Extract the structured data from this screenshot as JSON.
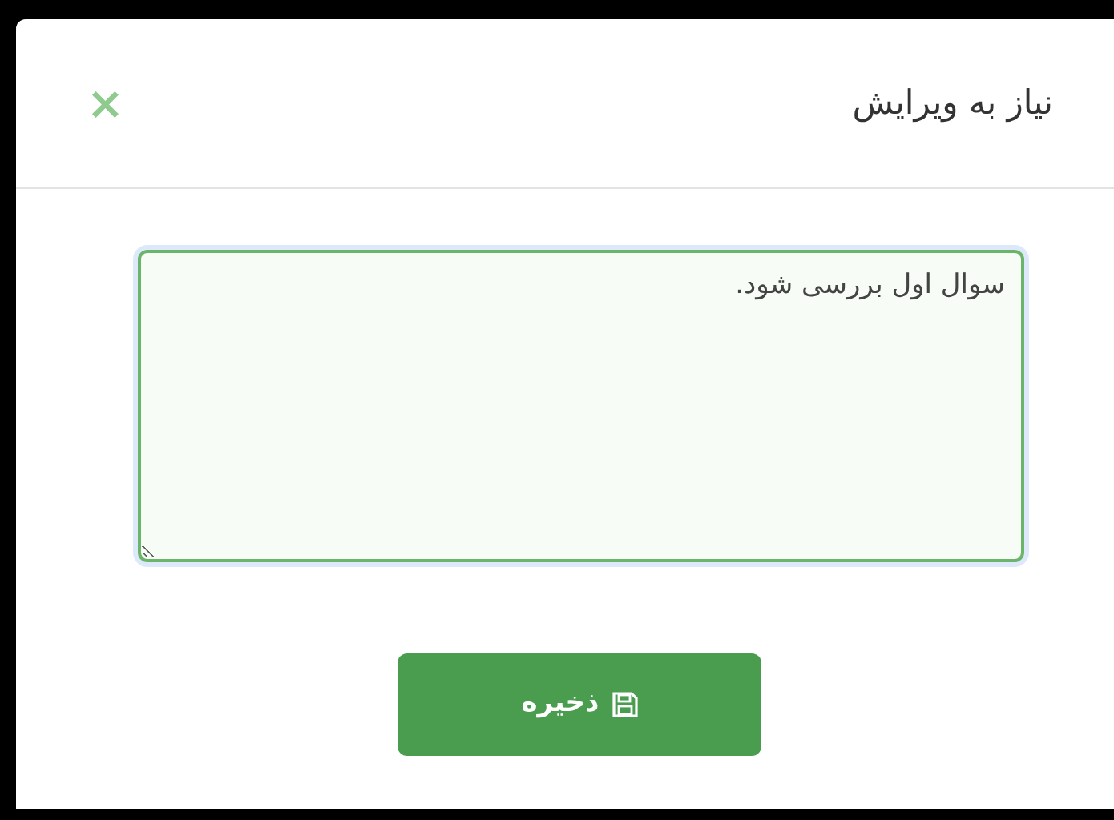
{
  "dialog": {
    "title": "نیاز به ویرایش",
    "close_label": "×"
  },
  "comment": {
    "value": "سوال اول بررسی شود."
  },
  "save_button": {
    "label": "ذخیره"
  }
}
